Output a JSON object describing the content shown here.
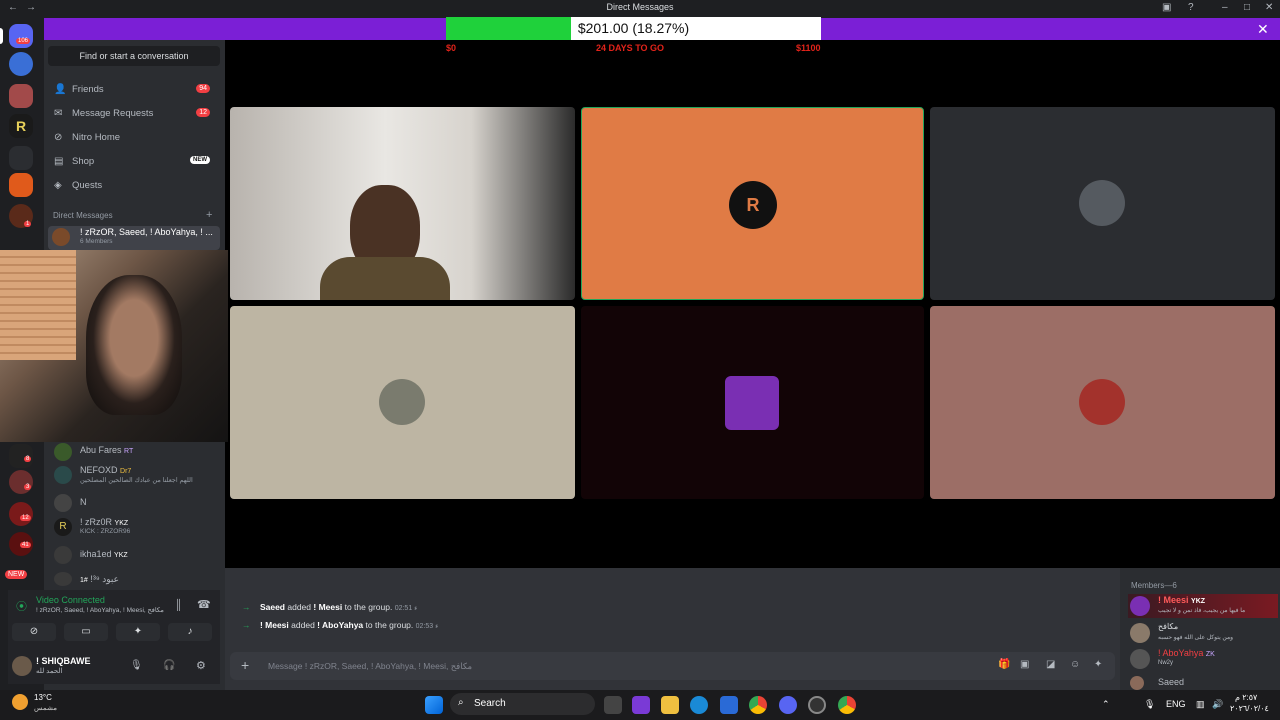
{
  "window": {
    "title": "Direct Messages",
    "controls": [
      "back-arrow",
      "forward-arrow",
      "minimize",
      "maximize",
      "close"
    ]
  },
  "donation": {
    "amount_text": "$201.00 (18.27%)",
    "progress": 0.1827,
    "min_label": "$0",
    "mid_label": "24 DAYS TO GO",
    "max_label": "$1100",
    "fill_color": "#1fd13b",
    "bar_color": "#7b1fd6"
  },
  "rail": {
    "home_badge": "106",
    "badges": [
      "1",
      "8",
      "3",
      "12",
      "41"
    ],
    "new_label": "NEW"
  },
  "sidebar": {
    "find_placeholder": "Find or start a conversation",
    "nav": [
      {
        "icon": "friends-icon",
        "label": "Friends",
        "badge": "94"
      },
      {
        "icon": "message-requests-icon",
        "label": "Message Requests",
        "badge": "12"
      },
      {
        "icon": "nitro-icon",
        "label": "Nitro Home",
        "badge": ""
      },
      {
        "icon": "shop-icon",
        "label": "Shop",
        "badge": "NEW"
      },
      {
        "icon": "quests-icon",
        "label": "Quests",
        "badge": ""
      }
    ],
    "dm_header": "Direct Messages",
    "group": {
      "name": "! zRzOR, Saeed, ! AboYahya, ! ...",
      "sub": "6 Members"
    },
    "dms": [
      {
        "name": "Abu Fares",
        "tag": "RT",
        "sub": ""
      },
      {
        "name": "NEFOXD",
        "tag": "Dr7",
        "sub": "اللهم اجعلنا من عبادك الصالحين المصلحين"
      },
      {
        "name": "N",
        "tag": "",
        "sub": ""
      },
      {
        "name": "! zRz0R",
        "tag": "YKZ",
        "sub": "KICK : ZRZOR96"
      },
      {
        "name": "ikha1ed",
        "tag": "YKZ",
        "sub": ""
      },
      {
        "name": "عبود ³⁹!",
        "tag": "#1",
        "sub": ""
      }
    ]
  },
  "voice": {
    "status": "Video Connected",
    "channel": "! zRzOR, Saeed, ! AboYahya, ! Meesi, مكافح"
  },
  "user": {
    "name": "! SHIQBAWE",
    "status": "الحمد لله"
  },
  "video_tiles": [
    {
      "type": "camera",
      "color": "#8a8580"
    },
    {
      "type": "avatar",
      "color": "#e07b45",
      "avatar_color": "#111"
    },
    {
      "type": "avatar",
      "color": "#2b2d31",
      "avatar_color": "#555a60"
    },
    {
      "type": "avatar",
      "color": "#bdb5a3",
      "avatar_color": "#7a7b6e"
    },
    {
      "type": "avatar",
      "color": "#120406",
      "avatar_color": "#7a2fb3"
    },
    {
      "type": "avatar",
      "color": "#9c6e66",
      "avatar_color": "#a3322c"
    }
  ],
  "chat": {
    "messages": [
      {
        "actor": "Saeed",
        "verb": "added",
        "target": "! Meesi",
        "tail": "to the group.",
        "time": "02:51 ﺀ"
      },
      {
        "actor": "! Meesi",
        "verb": "added",
        "target": "! AboYahya",
        "tail": "to the group.",
        "time": "02:53 ﺀ"
      }
    ],
    "input_placeholder": "Message ! zRzOR, Saeed, ! AboYahya, ! Meesi, مكافح"
  },
  "members": {
    "header": "Members—6",
    "list": [
      {
        "name": "! Meesi",
        "tag": "YKZ",
        "status": "ما فيها من يجيب، فاذ تمن و لا تجيب",
        "color": "#f23f43"
      },
      {
        "name": "مكافح",
        "tag": "",
        "status": "ومن يتوكل على الله فهو حسبه",
        "color": "#dbdee1"
      },
      {
        "name": "! AboYahya",
        "tag": "ZK",
        "status": "Nw2y",
        "color": "#f23f43"
      },
      {
        "name": "Saeed",
        "tag": "",
        "status": "",
        "color": "#b5bac1"
      }
    ]
  },
  "taskbar": {
    "weather_temp": "13°C",
    "weather_desc": "مشمس",
    "search_label": "Search",
    "lang": "ENG",
    "time": "٢:٥٧ م",
    "date": "٢٠٢٦/٠٢/٠٤"
  }
}
